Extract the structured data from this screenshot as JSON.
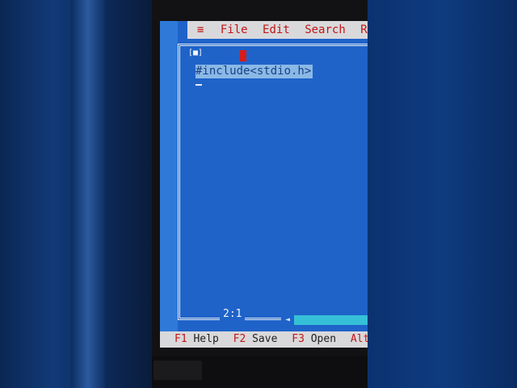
{
  "menu": {
    "system_symbol": "≡",
    "items": [
      "File",
      "Edit",
      "Search",
      "Run"
    ]
  },
  "editor": {
    "close_box": "[■]",
    "code_lines": [
      "#include<stdio.h>"
    ],
    "cursor_position": "2:1"
  },
  "function_keys": [
    {
      "key": "F1",
      "label": "Help"
    },
    {
      "key": "F2",
      "label": "Save"
    },
    {
      "key": "F3",
      "label": "Open"
    },
    {
      "key": "Alt-F",
      "label": ""
    }
  ],
  "colors": {
    "editor_background": "#1f63c9",
    "menu_background": "#d9d9db",
    "menu_text": "#c21616",
    "selection": "#8ab9e6"
  }
}
